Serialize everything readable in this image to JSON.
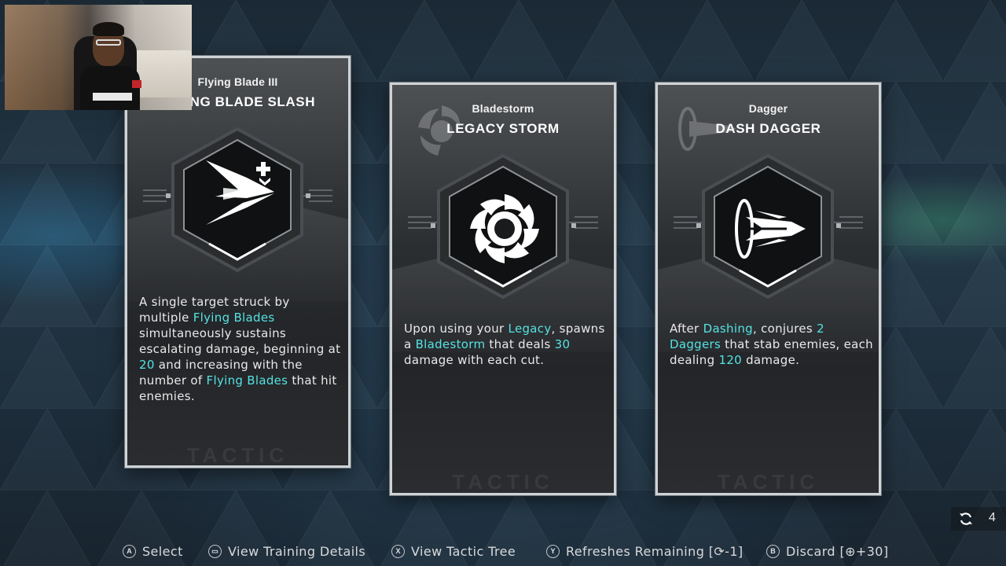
{
  "cards": [
    {
      "subtitle": "Flying Blade III",
      "title": "FLYING BLADE SLASH",
      "icon": "flying-blade-icon",
      "description": [
        {
          "t": "A single target struck by multiple "
        },
        {
          "t": "Flying Blades",
          "hl": true
        },
        {
          "t": " simultaneously sustains escalating damage, beginning at "
        },
        {
          "t": "20",
          "hl": true
        },
        {
          "t": " and increasing with the number of "
        },
        {
          "t": "Flying Blades",
          "hl": true
        },
        {
          "t": " that hit enemies."
        }
      ],
      "watermark": "TACTIC"
    },
    {
      "subtitle": "Bladestorm",
      "title": "LEGACY STORM",
      "icon": "bladestorm-icon",
      "description": [
        {
          "t": "Upon using your "
        },
        {
          "t": "Legacy",
          "hl": true
        },
        {
          "t": ", spawns a "
        },
        {
          "t": "Bladestorm",
          "hl": true
        },
        {
          "t": " that deals "
        },
        {
          "t": "30",
          "hl": true
        },
        {
          "t": " damage with each cut."
        }
      ],
      "watermark": "TACTIC"
    },
    {
      "subtitle": "Dagger",
      "title": "DASH DAGGER",
      "icon": "dash-dagger-icon",
      "description": [
        {
          "t": "After "
        },
        {
          "t": "Dashing",
          "hl": true
        },
        {
          "t": ", conjures "
        },
        {
          "t": "2 Daggers",
          "hl": true
        },
        {
          "t": " that stab enemies, each dealing "
        },
        {
          "t": "120",
          "hl": true
        },
        {
          "t": " damage."
        }
      ],
      "watermark": "TACTIC"
    }
  ],
  "refresh": {
    "count": "4",
    "icon": "refresh-icon"
  },
  "hints": [
    {
      "button": "A",
      "label": "Select"
    },
    {
      "button": "▭",
      "label": "View Training Details"
    },
    {
      "button": "X",
      "label": "View Tactic Tree"
    },
    {
      "button": "Y",
      "label": "Refreshes Remaining [⟳-1]"
    },
    {
      "button": "B",
      "label": "Discard [⊕+30]"
    }
  ],
  "colors": {
    "highlight": "#55e2e2",
    "text": "#e9e9e9",
    "card_border": "#cfd3d6"
  }
}
